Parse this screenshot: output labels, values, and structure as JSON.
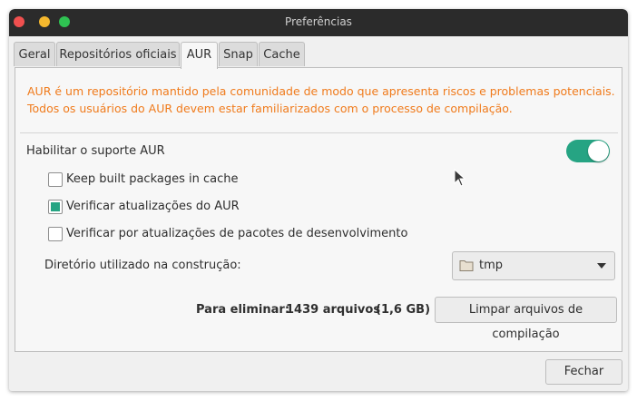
{
  "window": {
    "title": "Preferências"
  },
  "tabs": [
    {
      "label": "Geral"
    },
    {
      "label": "Repositórios oficiais"
    },
    {
      "label": "AUR"
    },
    {
      "label": "Snap"
    },
    {
      "label": "Cache"
    }
  ],
  "active_tab": "AUR",
  "aur": {
    "warning_line1": "AUR é um repositório mantido pela comunidade de modo que apresenta riscos e problemas potenciais.",
    "warning_line2": "Todos os usuários do AUR devem estar familiarizados com o processo de compilação.",
    "enable_label": "Habilitar o suporte AUR",
    "enable_on": true,
    "options": [
      {
        "label": "Keep built packages in cache",
        "checked": false
      },
      {
        "label": "Verificar atualizações do AUR",
        "checked": true
      },
      {
        "label": "Verificar por atualizações de pacotes de desenvolvimento",
        "checked": false
      }
    ],
    "build_dir_label": "Diretório utilizado na construção:",
    "build_dir_value": "tmp",
    "remove_label": "Para eliminar:",
    "remove_count": "1439 arquivos",
    "remove_size": "(1,6 GB)",
    "clean_button": "Limpar arquivos de compilação"
  },
  "footer": {
    "close_button": "Fechar"
  },
  "colors": {
    "accent": "#26a483",
    "warning": "#f07b1c",
    "titlebar": "#2b2b2b"
  },
  "icons": {
    "folder": "folder-icon",
    "dropdown": "dropdown-arrow-icon"
  }
}
